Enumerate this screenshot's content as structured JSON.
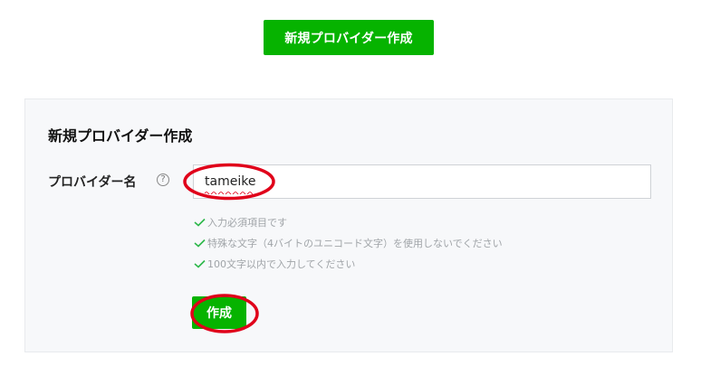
{
  "header": {
    "create_button_label": "新規プロバイダー作成"
  },
  "form": {
    "title": "新規プロバイダー作成",
    "provider_name_label": "プロバイダー名",
    "help_icon_glyph": "?",
    "provider_name_value": "tameike",
    "validation_rules": [
      "入力必須項目です",
      "特殊な文字（4バイトのユニコード文字）を使用しないでください",
      "100文字以内で入力してください"
    ],
    "submit_label": "作成"
  },
  "colors": {
    "accent_green": "#06b300",
    "check_green": "#2db84a",
    "annotation_red": "#e0001a"
  },
  "icons": [
    "help-icon",
    "check-icon"
  ]
}
